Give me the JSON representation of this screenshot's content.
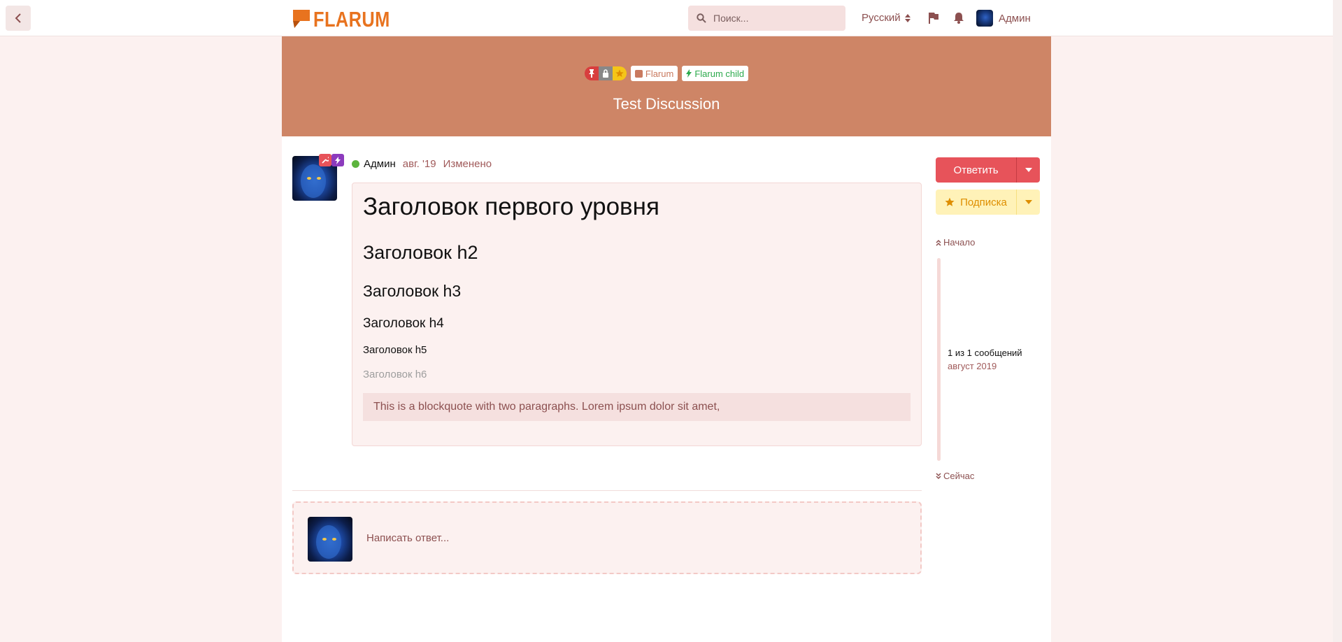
{
  "header": {
    "logo_text": "FLARUM",
    "search_placeholder": "Поиск...",
    "language": "Русский",
    "username": "Админ"
  },
  "discussion": {
    "title": "Test Discussion",
    "tags": [
      {
        "label": "Flarum",
        "color": "#c97a5f"
      },
      {
        "label": "Flarum child",
        "color": "#2daa4d"
      }
    ],
    "badges": [
      "pinned-icon",
      "lock-icon",
      "star-icon"
    ]
  },
  "post": {
    "author": "Админ",
    "date": "авг. '19",
    "edited": "Изменено",
    "h1": "Заголовок первого уровня",
    "h2": "Заголовок h2",
    "h3": "Заголовок h3",
    "h4": "Заголовок h4",
    "h5": "Заголовок h5",
    "h6": "Заголовок h6",
    "blockquote": "This is a blockquote with two paragraphs. Lorem ipsum dolor sit amet,"
  },
  "composer": {
    "placeholder": "Написать ответ..."
  },
  "sidebar": {
    "reply_label": "Ответить",
    "subscribe_label": "Подписка",
    "start_label": "Начало",
    "count_label": "1 из 1 сообщений",
    "date_label": "август 2019",
    "now_label": "Сейчас"
  },
  "colors": {
    "hero": "#ce8566",
    "primary": "#e7535a",
    "subscribe_bg": "#fff2b8",
    "subscribe_text": "#de8e00",
    "logo": "#e8731f"
  }
}
